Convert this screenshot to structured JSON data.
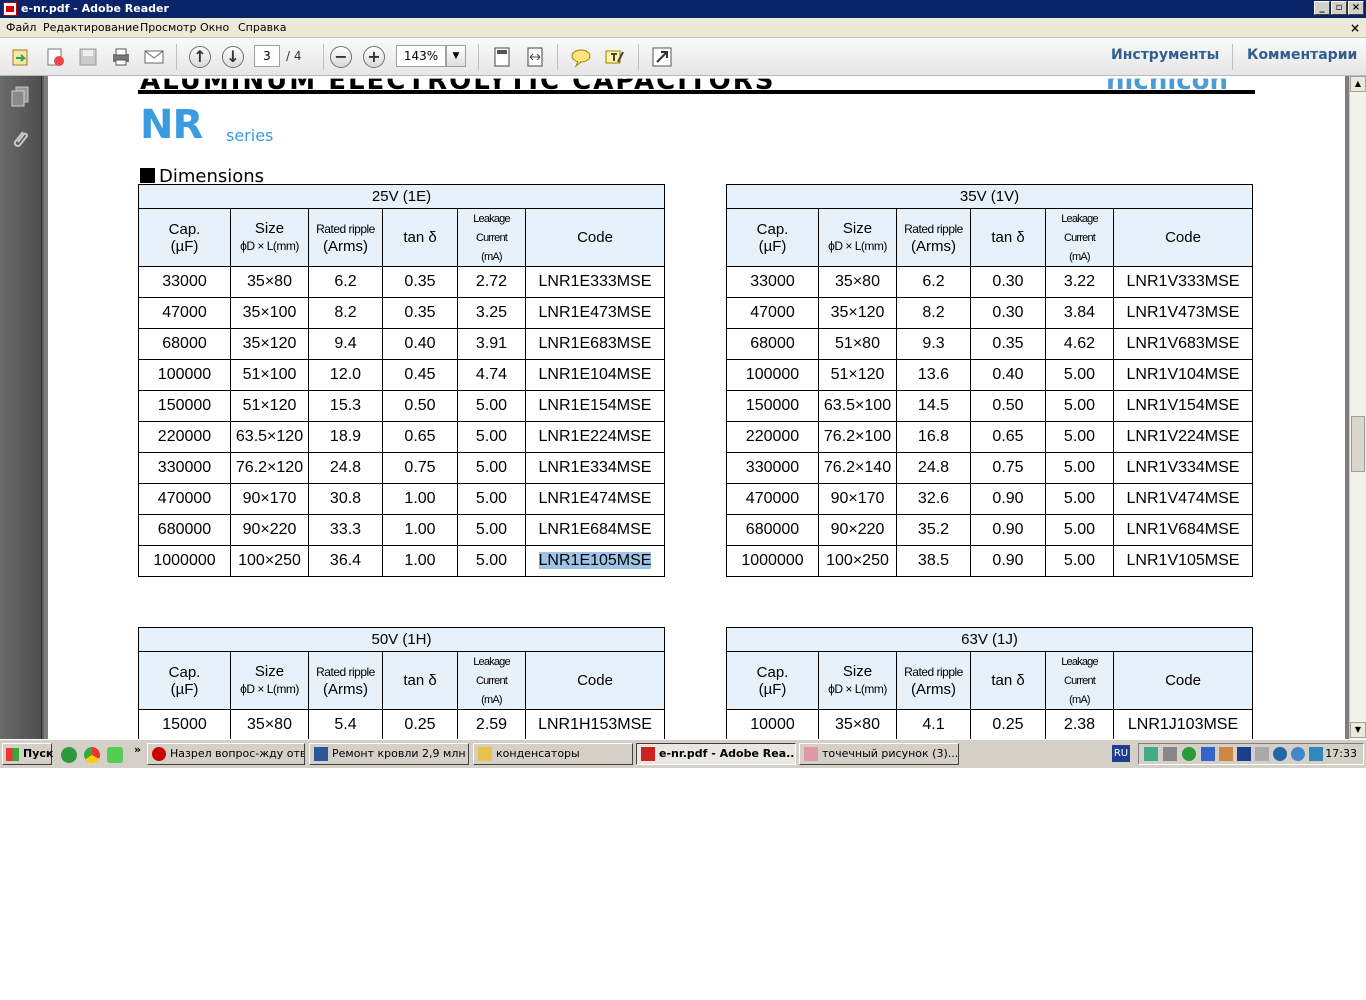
{
  "window": {
    "title": "e-nr.pdf - Adobe Reader"
  },
  "menubar": {
    "items": [
      "Файл",
      "Редактирование",
      "Просмотр",
      "Окно",
      "Справка"
    ]
  },
  "toolbar": {
    "page_current": "3",
    "page_total": "/ 4",
    "zoom": "143%",
    "tools_label": "Инструменты",
    "comments_label": "Комментарии"
  },
  "document": {
    "header_text": "ALUMINUM ELECTROLYTIC CAPACITORS",
    "brand": "nichicon",
    "series_code": "NR",
    "series_word": "series",
    "section_title": "Dimensions",
    "columns": {
      "cap_line1": "Cap.",
      "cap_line2": "(µF)",
      "size_line1": "Size",
      "size_line2": "ϕD × L(mm)",
      "ripple_line1": "Rated ripple",
      "ripple_line2": "(Arms)",
      "tan": "tan  δ",
      "leak_line1": "Leakage Current",
      "leak_line2": "(mA)",
      "code": "Code"
    },
    "tables": [
      {
        "voltage": "25V (1E)",
        "rows": [
          [
            "33000",
            "35×80",
            "6.2",
            "0.35",
            "2.72",
            "LNR1E333MSE"
          ],
          [
            "47000",
            "35×100",
            "8.2",
            "0.35",
            "3.25",
            "LNR1E473MSE"
          ],
          [
            "68000",
            "35×120",
            "9.4",
            "0.40",
            "3.91",
            "LNR1E683MSE"
          ],
          [
            "100000",
            "51×100",
            "12.0",
            "0.45",
            "4.74",
            "LNR1E104MSE"
          ],
          [
            "150000",
            "51×120",
            "15.3",
            "0.50",
            "5.00",
            "LNR1E154MSE"
          ],
          [
            "220000",
            "63.5×120",
            "18.9",
            "0.65",
            "5.00",
            "LNR1E224MSE"
          ],
          [
            "330000",
            "76.2×120",
            "24.8",
            "0.75",
            "5.00",
            "LNR1E334MSE"
          ],
          [
            "470000",
            "90×170",
            "30.8",
            "1.00",
            "5.00",
            "LNR1E474MSE"
          ],
          [
            "680000",
            "90×220",
            "33.3",
            "1.00",
            "5.00",
            "LNR1E684MSE"
          ],
          [
            "1000000",
            "100×250",
            "36.4",
            "1.00",
            "5.00",
            "LNR1E105MSE"
          ]
        ],
        "selected_text": "LNR1E105MSE"
      },
      {
        "voltage": "35V (1V)",
        "rows": [
          [
            "33000",
            "35×80",
            "6.2",
            "0.30",
            "3.22",
            "LNR1V333MSE"
          ],
          [
            "47000",
            "35×120",
            "8.2",
            "0.30",
            "3.84",
            "LNR1V473MSE"
          ],
          [
            "68000",
            "51×80",
            "9.3",
            "0.35",
            "4.62",
            "LNR1V683MSE"
          ],
          [
            "100000",
            "51×120",
            "13.6",
            "0.40",
            "5.00",
            "LNR1V104MSE"
          ],
          [
            "150000",
            "63.5×100",
            "14.5",
            "0.50",
            "5.00",
            "LNR1V154MSE"
          ],
          [
            "220000",
            "76.2×100",
            "16.8",
            "0.65",
            "5.00",
            "LNR1V224MSE"
          ],
          [
            "330000",
            "76.2×140",
            "24.8",
            "0.75",
            "5.00",
            "LNR1V334MSE"
          ],
          [
            "470000",
            "90×170",
            "32.6",
            "0.90",
            "5.00",
            "LNR1V474MSE"
          ],
          [
            "680000",
            "90×220",
            "35.2",
            "0.90",
            "5.00",
            "LNR1V684MSE"
          ],
          [
            "1000000",
            "100×250",
            "38.5",
            "0.90",
            "5.00",
            "LNR1V105MSE"
          ]
        ]
      },
      {
        "voltage": "50V (1H)",
        "rows": [
          [
            "15000",
            "35×80",
            "5.4",
            "0.25",
            "2.59",
            "LNR1H153MSE"
          ]
        ]
      },
      {
        "voltage": "63V (1J)",
        "rows": [
          [
            "10000",
            "35×80",
            "4.1",
            "0.25",
            "2.38",
            "LNR1J103MSE"
          ]
        ]
      }
    ]
  },
  "taskbar": {
    "start_label": "Пуск",
    "tasks": [
      {
        "label": "Назрел вопрос-жду отв...",
        "icon": "opera-icon",
        "active": false
      },
      {
        "label": "Ремонт кровли 2,9 млн ...",
        "icon": "word-document-icon",
        "active": false
      },
      {
        "label": "конденсаторы",
        "icon": "folder-icon",
        "active": false
      },
      {
        "label": "e-nr.pdf - Adobe Rea...",
        "icon": "pdf-icon",
        "active": true
      },
      {
        "label": "точечный рисунок (3)....",
        "icon": "paint-icon",
        "active": false
      }
    ],
    "language": "RU",
    "clock": "17:33"
  },
  "colors": {
    "titlebar": "#0a246a",
    "series_blue": "#3a9be0",
    "table_header_bg": "#e6f1fa",
    "selection": "#9fc3e6"
  }
}
